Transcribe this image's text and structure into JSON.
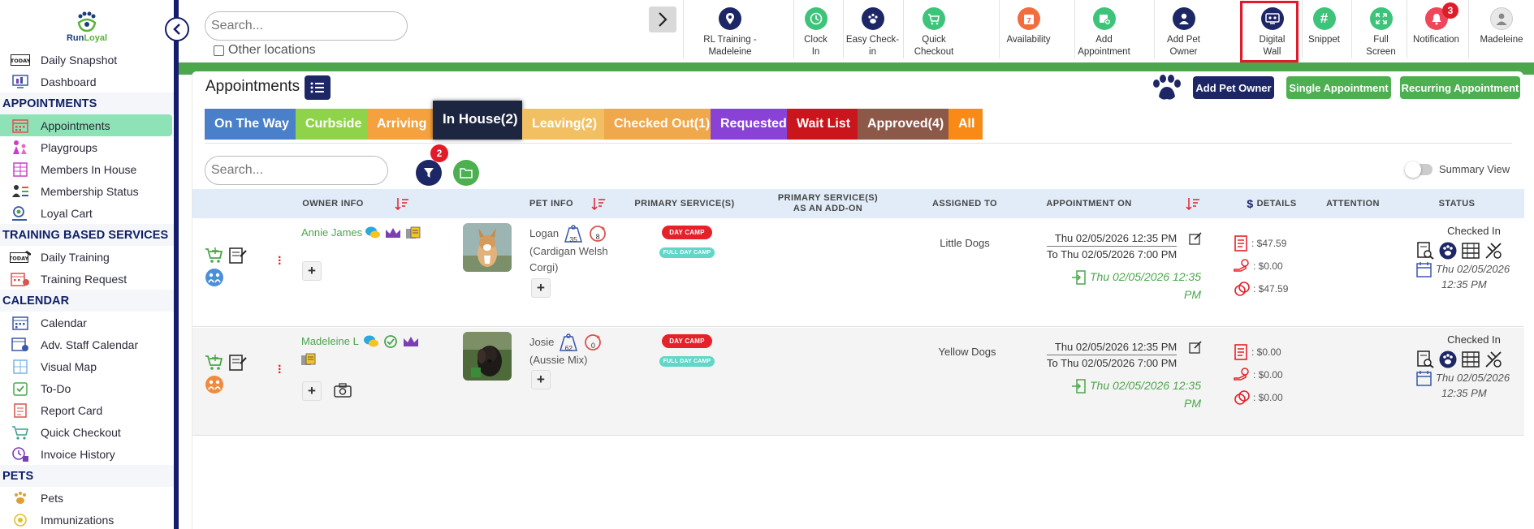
{
  "brand": {
    "name_a": "Run",
    "name_b": "Loyal"
  },
  "sidebar": {
    "items": [
      {
        "label": "Daily Snapshot"
      },
      {
        "label": "Dashboard"
      }
    ],
    "sections": [
      {
        "title": "APPOINTMENTS",
        "items": [
          "Appointments",
          "Playgroups",
          "Members In House",
          "Membership Status",
          "Loyal Cart"
        ]
      },
      {
        "title": "TRAINING BASED SERVICES",
        "items": [
          "Daily Training",
          "Training Request"
        ]
      },
      {
        "title": "CALENDAR",
        "items": [
          "Calendar",
          "Adv. Staff Calendar",
          "Visual Map",
          "To-Do",
          "Report Card",
          "Quick Checkout",
          "Invoice History"
        ]
      },
      {
        "title": "PETS",
        "items": [
          "Pets",
          "Immunizations"
        ]
      }
    ],
    "active": "Appointments"
  },
  "topbar": {
    "search_placeholder": "Search...",
    "other_locations": "Other locations",
    "buttons": [
      {
        "label1": "RL Training -",
        "label2": "Madeleine"
      },
      {
        "label1": "Clock",
        "label2": "In"
      },
      {
        "label1": "Easy Check-",
        "label2": "in"
      },
      {
        "label1": "Quick",
        "label2": "Checkout"
      },
      {
        "label1": "Availability",
        "label2": ""
      },
      {
        "label1": "Add",
        "label2": "Appointment"
      },
      {
        "label1": "Add Pet",
        "label2": "Owner"
      },
      {
        "label1": "Digital",
        "label2": "Wall"
      },
      {
        "label1": "Snippet",
        "label2": ""
      },
      {
        "label1": "Full",
        "label2": "Screen"
      },
      {
        "label1": "Notification",
        "label2": ""
      },
      {
        "label1": "Madeleine",
        "label2": ""
      }
    ],
    "notification_count": "3"
  },
  "main": {
    "title": "Appointments",
    "add_pet_owner": "Add Pet Owner",
    "single_appointment": "Single Appointment",
    "recurring_appointment": "Recurring Appointment",
    "tabs": [
      {
        "label": "On The Way",
        "color": "#4a7fc9"
      },
      {
        "label": "Curbside",
        "color": "#8fd34a"
      },
      {
        "label": "Arriving",
        "color": "#f5a23e"
      },
      {
        "label": "In House(2)",
        "color": "#1d2640"
      },
      {
        "label": "Leaving(2)",
        "color": "#f2c063"
      },
      {
        "label": "Checked Out(1)",
        "color": "#f0a84c"
      },
      {
        "label": "Requested",
        "color": "#8a42d6"
      },
      {
        "label": "Wait List",
        "color": "#c9151b"
      },
      {
        "label": "Approved(4)",
        "color": "#8c5848"
      },
      {
        "label": "All",
        "color": "#f98a16"
      }
    ],
    "list_search_placeholder": "Search...",
    "filter_count": "2",
    "summary_view": "Summary View",
    "columns": {
      "owner": "OWNER INFO",
      "pet": "PET INFO",
      "primary": "PRIMARY SERVICE(S)",
      "addon1": "PRIMARY SERVICE(S)",
      "addon2": "AS AN ADD-ON",
      "assigned": "ASSIGNED TO",
      "appt": "APPOINTMENT ON",
      "details": "DETAILS",
      "dollar": "$",
      "attention": "ATTENTION",
      "status": "STATUS"
    },
    "rows": [
      {
        "owner": "Annie James",
        "pet": "Logan",
        "pet_breed1": "(Cardigan Welsh",
        "pet_breed2": "Corgi)",
        "weight": "35",
        "visits": "8",
        "service1": "DAY CAMP",
        "service2": "FULL DAY CAMP",
        "assigned": "Little Dogs",
        "from": "Thu 02/05/2026 12:35 PM",
        "to": "To Thu 02/05/2026 7:00 PM",
        "checkin1": "Thu 02/05/2026 12:35",
        "checkin2": "PM",
        "d1": ": $47.59",
        "d2": ": $0.00",
        "d3": ": $47.59",
        "status": "Checked In",
        "status_date1": "Thu 02/05/2026",
        "status_date2": "12:35 PM"
      },
      {
        "owner": "Madeleine L",
        "pet": "Josie",
        "pet_breed1": "(Aussie Mix)",
        "pet_breed2": "",
        "weight": "62",
        "visits": "0",
        "service1": "DAY CAMP",
        "service2": "FULL DAY CAMP",
        "assigned": "Yellow Dogs",
        "from": "Thu 02/05/2026 12:35 PM",
        "to": "To Thu 02/05/2026 7:00 PM",
        "checkin1": "Thu 02/05/2026 12:35",
        "checkin2": "PM",
        "d1": ": $0.00",
        "d2": ": $0.00",
        "d3": ": $0.00",
        "status": "Checked In",
        "status_date1": "Thu 02/05/2026",
        "status_date2": "12:35 PM"
      }
    ]
  }
}
